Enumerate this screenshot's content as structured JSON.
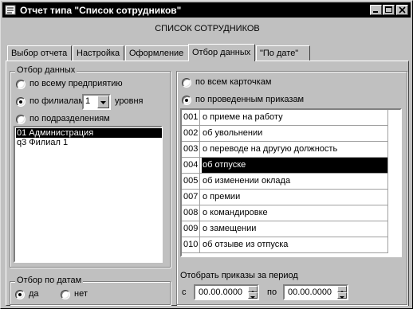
{
  "window": {
    "title": "Отчет типа \"Список сотрудников\""
  },
  "heading": "СПИСОК СОТРУДНИКОВ",
  "tabs": [
    {
      "label": "Выбор отчета"
    },
    {
      "label": "Настройка"
    },
    {
      "label": "Оформление"
    },
    {
      "label": "Отбор данных",
      "active": true
    },
    {
      "label": "\"По дате\""
    }
  ],
  "data_filter": {
    "group_label": "Отбор данных",
    "opt_all": "по всему предприятию",
    "opt_branch": "по филиалам",
    "level_value": "1",
    "level_suffix": "уровня",
    "opt_dept": "по подразделениям",
    "list": [
      "01 Администрация",
      "q3 Филиал 1"
    ],
    "selected_index": 0
  },
  "date_filter": {
    "group_label": "Отбор по датам",
    "yes": "да",
    "no": "нет"
  },
  "orders": {
    "opt_all_cards": "по всем карточкам",
    "opt_orders": "по проведенным приказам",
    "rows": [
      {
        "code": "001",
        "name": "о приеме на работу"
      },
      {
        "code": "002",
        "name": "об увольнении"
      },
      {
        "code": "003",
        "name": "о переводе на другую должность"
      },
      {
        "code": "004",
        "name": "об отпуске"
      },
      {
        "code": "005",
        "name": "об изменении оклада"
      },
      {
        "code": "007",
        "name": "о премии"
      },
      {
        "code": "008",
        "name": "о командировке"
      },
      {
        "code": "009",
        "name": "о замещении"
      },
      {
        "code": "010",
        "name": "об отзыве из отпуска"
      }
    ],
    "selected_index": 3
  },
  "period": {
    "label": "Отобрать приказы за период",
    "from_label": "с",
    "from_value": "00.00.0000",
    "to_label": "по",
    "to_value": "00.00.0000"
  },
  "icons": [
    "app-icon",
    "minimize-icon",
    "maximize-icon",
    "close-icon",
    "dropdown-arrow-icon",
    "spin-up-icon",
    "spin-down-icon"
  ]
}
